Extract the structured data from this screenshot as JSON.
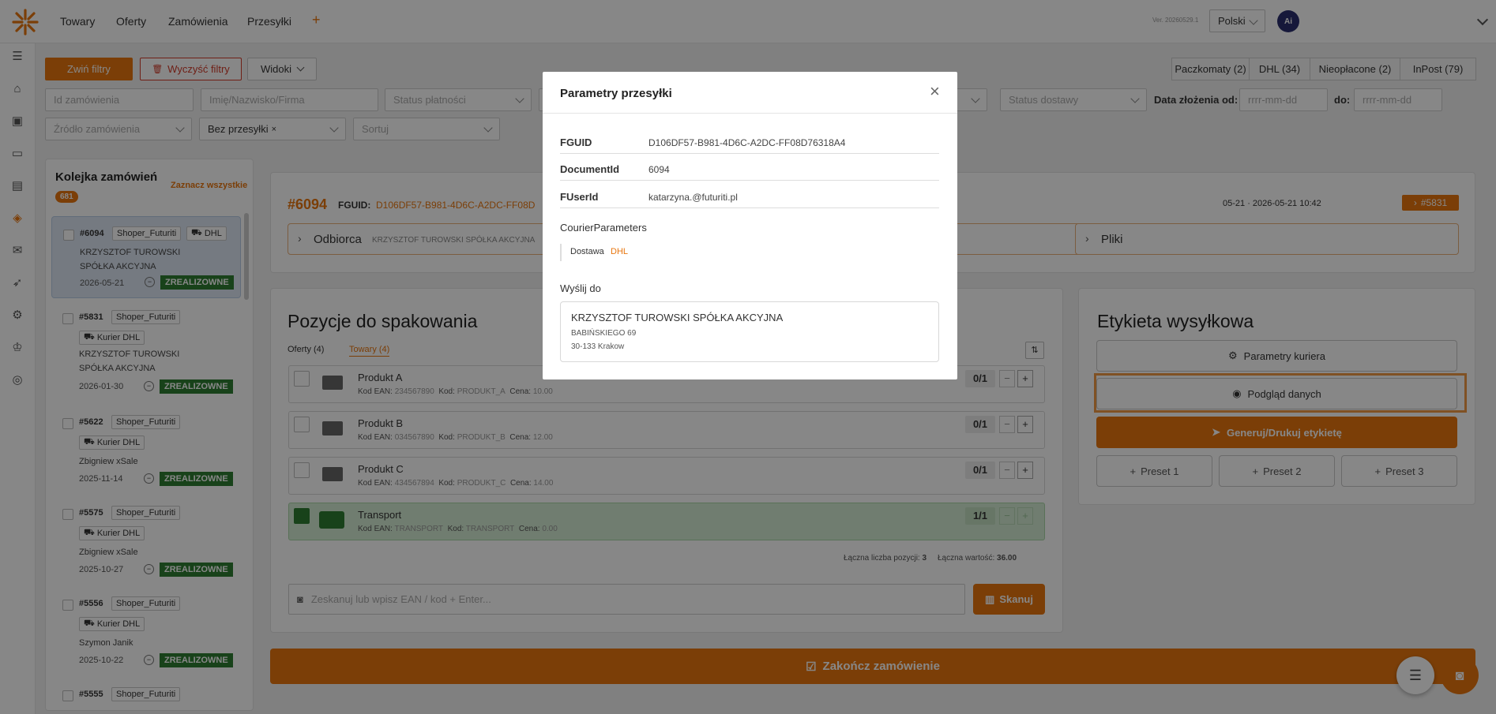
{
  "topbar": {
    "nav": [
      "Towary",
      "Oferty",
      "Zamówienia",
      "Przesyłki"
    ],
    "add": "+",
    "version": "Ver. 20260529.1",
    "language": "Polski",
    "avatar_text": "Ai"
  },
  "filters": {
    "collapse_label": "Zwiń filtry",
    "clear_label": "Wyczyść filtry",
    "views_label": "Widoki",
    "order_id_placeholder": "Id zamówienia",
    "name_placeholder": "Imię/Nazwisko/Firma",
    "payment_status": "Status płatności",
    "delivery_status": "Status dostawy",
    "date_from_label": "Data złożenia od:",
    "date_to_label": "do:",
    "date_placeholder": "rrrr-mm-dd",
    "source_label": "Źródło zamówienia",
    "shipment_chip": "Bez przesyłki",
    "sort_label": "Sortuj",
    "tabs": [
      "Paczkomaty (2)",
      "DHL (34)",
      "Nieopłacone (2)",
      "InPost (79)"
    ]
  },
  "queue": {
    "title": "Kolejka zamówień",
    "select_all": "Zaznacz wszystkie",
    "count": "681",
    "items": [
      {
        "id": "#6094",
        "shop": "Shoper_Futuriti",
        "courier": "DHL",
        "name": "KRZYSZTOF TUROWSKI SPÓŁKA AKCYJNA",
        "date": "2026-05-21",
        "status": "ZREALIZOWNE"
      },
      {
        "id": "#5831",
        "shop": "Shoper_Futuriti",
        "courier": "Kurier DHL",
        "name": "KRZYSZTOF TUROWSKI SPÓŁKA AKCYJNA",
        "date": "2026-01-30",
        "status": "ZREALIZOWNE"
      },
      {
        "id": "#5622",
        "shop": "Shoper_Futuriti",
        "courier": "Kurier DHL",
        "name": "Zbigniew xSale",
        "date": "2025-11-14",
        "status": "ZREALIZOWNE"
      },
      {
        "id": "#5575",
        "shop": "Shoper_Futuriti",
        "courier": "Kurier DHL",
        "name": "Zbigniew xSale",
        "date": "2025-10-27",
        "status": "ZREALIZOWNE"
      },
      {
        "id": "#5556",
        "shop": "Shoper_Futuriti",
        "courier": "Kurier DHL",
        "name": "Szymon Janik",
        "date": "2025-10-22",
        "status": "ZREALIZOWNE"
      },
      {
        "id": "#5555",
        "shop": "Shoper_Futuriti"
      }
    ]
  },
  "order": {
    "id": "#6094",
    "fguid_label": "FGUID:",
    "fguid": "D106DF57-B981-4D6C-A2DC-FF08D",
    "dates": "05-21 · 2026-05-21 10:42",
    "link_badge": "#5831",
    "recipient_label": "Odbiorca",
    "recipient_name": "KRZYSZTOF TUROWSKI SPÓŁKA AKCYJNA",
    "files_label": "Pliki"
  },
  "packing": {
    "title": "Pozycje do spakowania",
    "tab_offers": "Oferty (4)",
    "tab_goods": "Towary (4)",
    "ean_label": "Kod EAN:",
    "code_label": "Kod:",
    "price_label": "Cena:",
    "products": [
      {
        "name": "Produkt A",
        "ean": "234567890",
        "code": "PRODUKT_A",
        "price": "10.00",
        "qty": "0/1"
      },
      {
        "name": "Produkt B",
        "ean": "034567890",
        "code": "PRODUKT_B",
        "price": "12.00",
        "qty": "0/1"
      },
      {
        "name": "Produkt C",
        "ean": "434567894",
        "code": "PRODUKT_C",
        "price": "14.00",
        "qty": "0/1"
      },
      {
        "name": "Transport",
        "ean": "TRANSPORT",
        "code": "TRANSPORT",
        "price": "0.00",
        "qty": "1/1"
      }
    ],
    "total_count_label": "Łączna liczba pozycji:",
    "total_count": "3",
    "total_value_label": "Łączna wartość:",
    "total_value": "36.00",
    "scan_placeholder": "Zeskanuj lub wpisz EAN / kod + Enter...",
    "scan_button": "Skanuj"
  },
  "label_panel": {
    "title": "Etykieta wysyłkowa",
    "courier_params": "Parametry kuriera",
    "preview": "Podgląd danych",
    "generate": "Generuj/Drukuj etykietę",
    "presets": [
      "Preset 1",
      "Preset 2",
      "Preset 3"
    ]
  },
  "finish_button": "Zakończ zamówienie",
  "modal": {
    "title": "Parametry przesyłki",
    "fields": [
      {
        "label": "FGUID",
        "value": "D106DF57-B981-4D6C-A2DC-FF08D76318A4"
      },
      {
        "label": "DocumentId",
        "value": "6094"
      },
      {
        "label": "FUserId",
        "value": "katarzyna.@futuriti.pl"
      }
    ],
    "courier_params_label": "CourierParameters",
    "delivery_key": "Dostawa",
    "delivery_value": "DHL",
    "ship_to_label": "Wyślij do",
    "address": {
      "name": "KRZYSZTOF TUROWSKI SPÓŁKA AKCYJNA",
      "street": "BABIŃSKIEGO 69",
      "city": "30-133 Krakow"
    }
  },
  "colors": {
    "accent": "#e8760f",
    "success": "#2e7d32",
    "danger": "#d23b2a"
  }
}
